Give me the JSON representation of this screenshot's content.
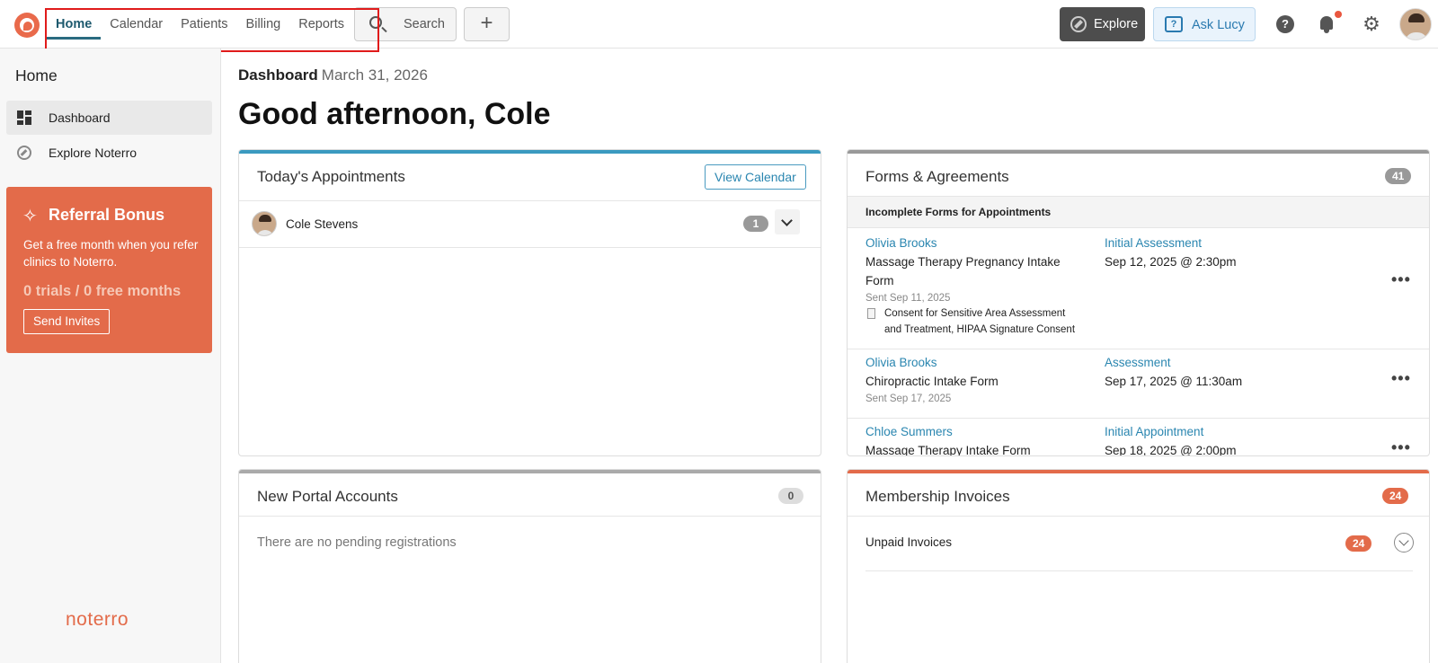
{
  "nav": {
    "items": [
      "Home",
      "Calendar",
      "Patients",
      "Billing",
      "Reports"
    ],
    "active": "Home",
    "search_label": "Search",
    "add_label": "+",
    "explore_label": "Explore",
    "lucy_label": "Ask Lucy"
  },
  "sidebar": {
    "heading": "Home",
    "items": [
      {
        "label": "Dashboard",
        "icon": "dashboard-icon",
        "active": true
      },
      {
        "label": "Explore Noterro",
        "icon": "compass-icon",
        "active": false
      }
    ],
    "referral": {
      "title": "Referral Bonus",
      "text": "Get a free month when you refer clinics to Noterro.",
      "stats": "0 trials / 0 free months",
      "button": "Send Invites"
    },
    "brand": "noterro"
  },
  "main": {
    "crumb_title": "Dashboard",
    "crumb_date": "March 31, 2026",
    "greeting": "Good afternoon, Cole"
  },
  "appointments": {
    "title": "Today's Appointments",
    "view_calendar": "View Calendar",
    "items": [
      {
        "name": "Cole Stevens",
        "count": "1"
      }
    ]
  },
  "forms": {
    "title": "Forms & Agreements",
    "count": "41",
    "subheading": "Incomplete Forms for Appointments",
    "rows": [
      {
        "patient": "Olivia Brooks",
        "form_line1": "Massage Therapy Pregnancy Intake",
        "form_line2": "Form",
        "sent": "Sent Sep 11, 2025",
        "docs_line1": "Consent for Sensitive Area Assessment",
        "docs_line2": "and Treatment, HIPAA Signature Consent",
        "appt_type": "Initial Assessment",
        "appt_time": "Sep 12, 2025 @ 2:30pm"
      },
      {
        "patient": "Olivia Brooks",
        "form_line1": "Chiropractic Intake Form",
        "sent": "Sent Sep 17, 2025",
        "appt_type": "Assessment",
        "appt_time": "Sep 17, 2025 @ 11:30am"
      },
      {
        "patient": "Chloe Summers",
        "form_line1": "Massage Therapy Intake Form",
        "appt_type": "Initial Appointment",
        "appt_time": "Sep 18, 2025 @ 2:00pm"
      }
    ],
    "more": "•••"
  },
  "portal": {
    "title": "New Portal Accounts",
    "count": "0",
    "empty": "There are no pending registrations"
  },
  "invoices": {
    "title": "Membership Invoices",
    "count": "24",
    "unpaid_label": "Unpaid Invoices",
    "unpaid_count": "24"
  },
  "colors": {
    "brand": "#e36b4a",
    "link": "#2a86b0",
    "appointments_bar": "#3a9ac0",
    "forms_bar": "#999999",
    "invoices_bar": "#e36b4a",
    "highlight": "#e01b1b"
  }
}
